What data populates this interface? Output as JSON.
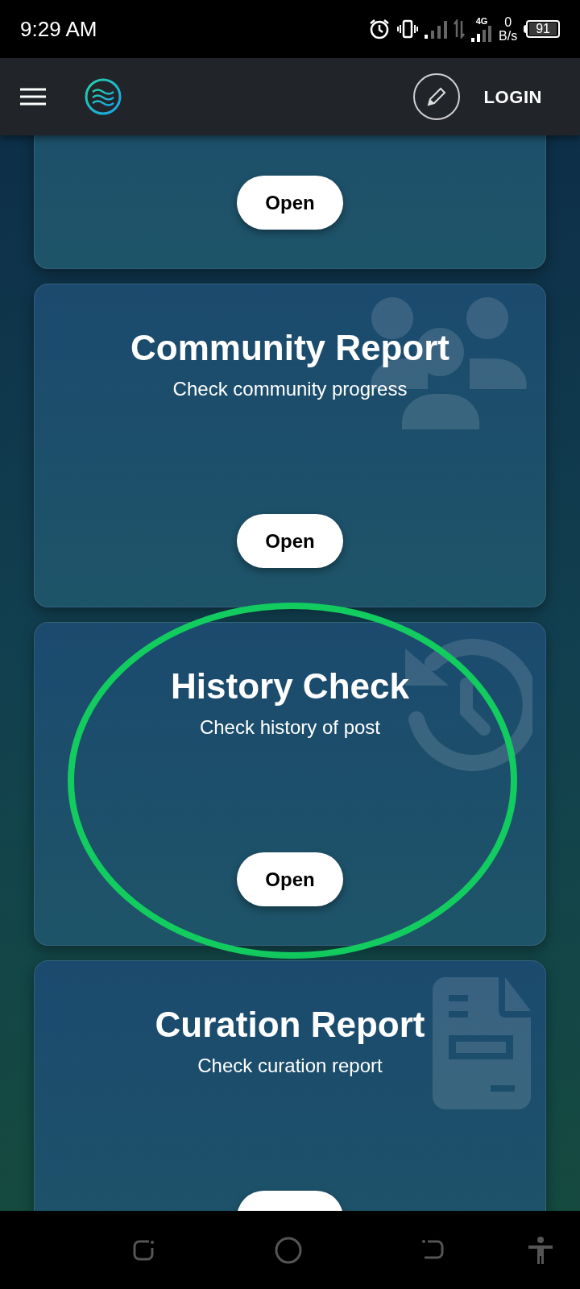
{
  "status_bar": {
    "time": "9:29 AM",
    "network": "4G",
    "speed_value": "0",
    "speed_unit": "B/s",
    "battery": "91"
  },
  "header": {
    "login": "LOGIN"
  },
  "cards": [
    {
      "kind": "plain",
      "highlighted": false,
      "button_cut": false,
      "button": {
        "label": "Open"
      }
    },
    {
      "title": "Community Report",
      "subtitle": "Check community progress",
      "kind": "users",
      "highlighted": false,
      "button_cut": false,
      "button": {
        "label": "Open"
      }
    },
    {
      "title": "History Check",
      "subtitle": "Check history of post",
      "kind": "history",
      "highlighted": true,
      "button_cut": false,
      "button": {
        "label": "Open"
      }
    },
    {
      "title": "Curation Report",
      "subtitle": "Check curation report",
      "kind": "document",
      "highlighted": false,
      "button_cut": true
    }
  ]
}
